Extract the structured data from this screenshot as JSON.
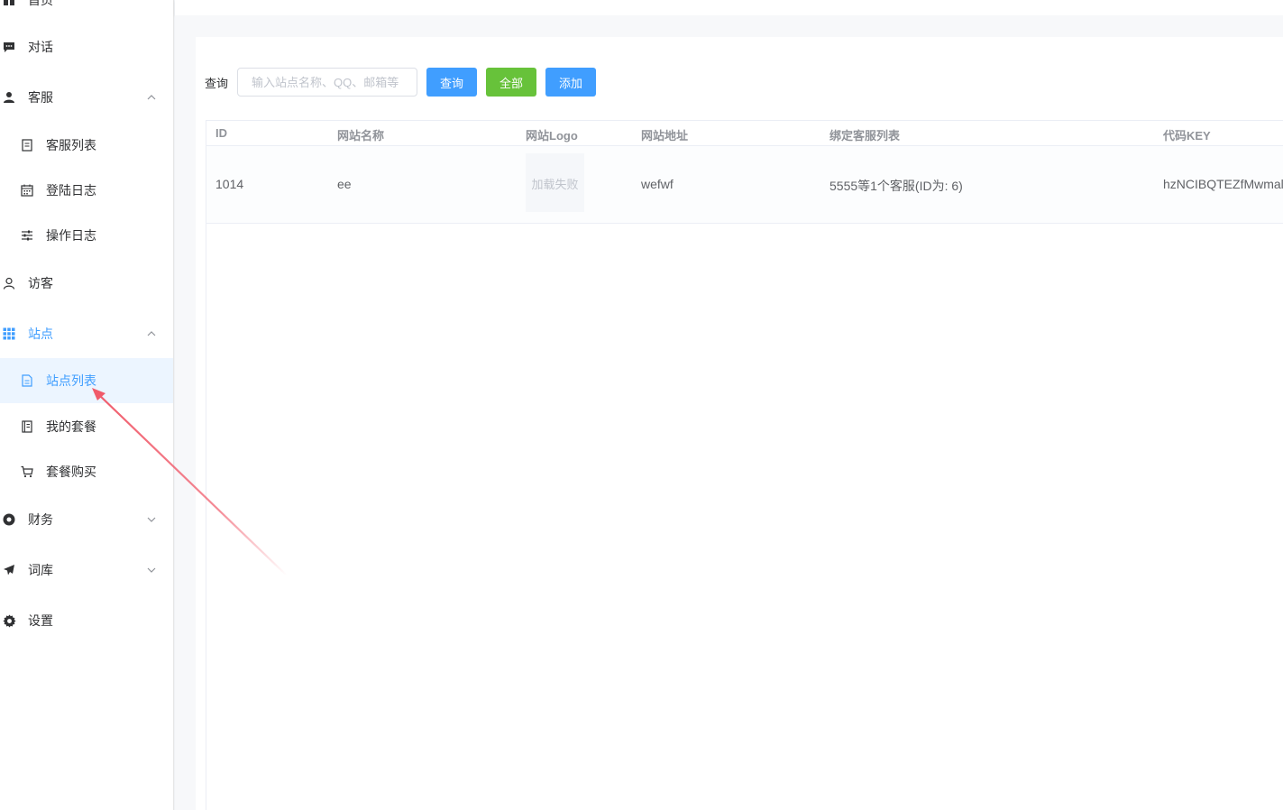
{
  "sidebar": {
    "top_partial_label": "首页",
    "items": [
      {
        "label": "对话"
      },
      {
        "label": "客服"
      },
      {
        "label": "客服列表"
      },
      {
        "label": "登陆日志"
      },
      {
        "label": "操作日志"
      },
      {
        "label": "访客"
      },
      {
        "label": "站点"
      },
      {
        "label": "站点列表"
      },
      {
        "label": "我的套餐"
      },
      {
        "label": "套餐购买"
      },
      {
        "label": "财务"
      },
      {
        "label": "词库"
      },
      {
        "label": "设置"
      }
    ],
    "active_item": "站点列表",
    "accent_color": "#409eff"
  },
  "toolbar": {
    "query_label": "查询",
    "search_placeholder": "输入站点名称、QQ、邮箱等",
    "search_value": "",
    "query_button": "查询",
    "all_button": "全部",
    "add_button": "添加"
  },
  "table": {
    "columns": [
      "ID",
      "网站名称",
      "网站Logo",
      "网站地址",
      "绑定客服列表",
      "代码KEY"
    ],
    "rows": [
      {
        "id": "1014",
        "name": "ee",
        "logo": "加载失败",
        "url": "wefwf",
        "agents": "5555等1个客服(ID为: 6)",
        "key": "hzNCIBQTEZfMwmal"
      }
    ]
  },
  "colors": {
    "primary": "#409eff",
    "success": "#67c23a",
    "annotation_arrow": "#f05a6a"
  }
}
